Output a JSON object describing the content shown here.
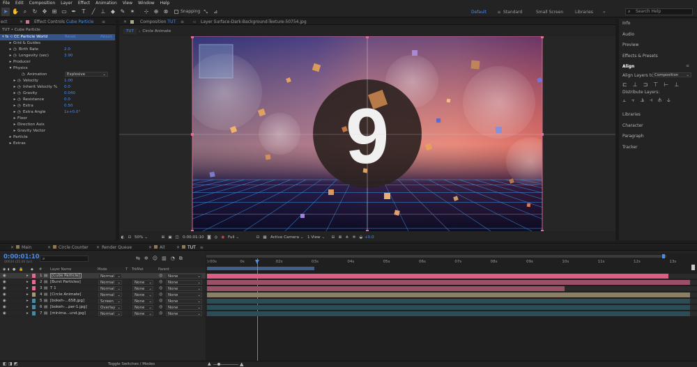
{
  "menu": [
    "File",
    "Edit",
    "Composition",
    "Layer",
    "Effect",
    "Animation",
    "View",
    "Window",
    "Help"
  ],
  "toolbar": {
    "snapping_label": "Snapping",
    "workspaces": [
      "Default",
      "Standard",
      "Small Screen",
      "Libraries"
    ],
    "active_workspace": "Default",
    "search_placeholder": "Search Help"
  },
  "effect_controls": {
    "panel_stub": "ect",
    "tab_prefix": "Effect Controls",
    "tab_layer": "Cube Particle",
    "breadcrumb": "TUT • Cube Particle",
    "effect_name": "CC Particle World",
    "reset_label": "Reset",
    "about_label": "About",
    "rows": [
      {
        "label": "Grid & Guides",
        "value": "",
        "indent": 1,
        "twirl": "▸"
      },
      {
        "label": "Birth Rate",
        "value": "2.0",
        "indent": 1,
        "twirl": "▸",
        "stopwatch": true
      },
      {
        "label": "Longevity (sec)",
        "value": "3.90",
        "indent": 1,
        "twirl": "▸",
        "stopwatch": true
      },
      {
        "label": "Producer",
        "value": "",
        "indent": 1,
        "twirl": "▸"
      },
      {
        "label": "Physics",
        "value": "",
        "indent": 1,
        "twirl": "▾"
      },
      {
        "label": "Animation",
        "value": "",
        "indent": 3,
        "twirl": "",
        "stopwatch": true
      },
      {
        "label": "Velocity",
        "value": "1.00",
        "indent": 2,
        "twirl": "▸",
        "stopwatch": true
      },
      {
        "label": "Inherit Velocity %",
        "value": "0.0",
        "indent": 2,
        "twirl": "▸",
        "stopwatch": true
      },
      {
        "label": "Gravity",
        "value": "0.040",
        "indent": 2,
        "twirl": "▸",
        "stopwatch": true
      },
      {
        "label": "Resistance",
        "value": "0.0",
        "indent": 2,
        "twirl": "▸",
        "stopwatch": true
      },
      {
        "label": "Extra",
        "value": "0.50",
        "indent": 2,
        "twirl": "▸",
        "stopwatch": true
      },
      {
        "label": "Extra Angle",
        "value": "1x+0.0°",
        "indent": 2,
        "twirl": "▸",
        "stopwatch": true
      },
      {
        "label": "Floor",
        "value": "",
        "indent": 2,
        "twirl": "▸"
      },
      {
        "label": "Direction Axis",
        "value": "",
        "indent": 2,
        "twirl": "▸"
      },
      {
        "label": "Gravity Vector",
        "value": "",
        "indent": 2,
        "twirl": "▸"
      },
      {
        "label": "Particle",
        "value": "",
        "indent": 1,
        "twirl": "▸"
      },
      {
        "label": "Extras",
        "value": "",
        "indent": 1,
        "twirl": "▸"
      }
    ],
    "animation_dropdown": "Explosive"
  },
  "composition": {
    "tab_prefix": "Composition",
    "tab_name": "TUT",
    "layer_tab": "Layer Surface-Dark-Background-Texture-50754.jpg",
    "breadcrumbs": [
      "TUT",
      "Circle Animate"
    ],
    "countdown_digit": "9",
    "footer": {
      "zoom": "50%",
      "timecode": "0:00:01:10",
      "resolution": "Full",
      "camera": "Active Camera",
      "view": "1 View",
      "exposure": "+0.0"
    }
  },
  "right_panel": {
    "items_top": [
      "Info",
      "Audio",
      "Preview",
      "Effects & Presets"
    ],
    "align_title": "Align",
    "align_to_label": "Align Layers to:",
    "align_to_value": "Composition",
    "distribute_label": "Distribute Layers:",
    "items_bottom": [
      "Libraries",
      "Character",
      "Paragraph",
      "Tracker"
    ]
  },
  "timeline": {
    "tabs": [
      {
        "label": "Main",
        "color": "#8c7a5a"
      },
      {
        "label": "Circle Counter",
        "color": "#8c7a5a"
      },
      {
        "label": "Render Queue",
        "color": ""
      },
      {
        "label": "All",
        "color": "#8c7a5a"
      },
      {
        "label": "TUT",
        "color": "#8c7a5a"
      }
    ],
    "timecode": "0:00:01:10",
    "frame_info": "00034 (25.00 fps)",
    "search_placeholder": "",
    "columns": {
      "num": "#",
      "layer_name": "Layer Name",
      "mode": "Mode",
      "t": "T",
      "trkmat": "TrkMat",
      "parent": "Parent"
    },
    "ruler_labels": [
      "):00s",
      "0s",
      "02s",
      "03s",
      "04s",
      "05s",
      "06s",
      "07s",
      "08s",
      "09s",
      "10s",
      "11s",
      "12s",
      "13s"
    ],
    "playhead_time_s": 1.4,
    "work_area_end_s": 3.0,
    "duration_s": 13.5,
    "layers": [
      {
        "num": "1",
        "name": "[Cube Particle]",
        "label_color": "#e06d8f",
        "mode": "Normal",
        "trkmat": "",
        "parent": "None",
        "selected": true,
        "bar_color": "#de5d84",
        "start_s": 0.0,
        "end_s": 12.9
      },
      {
        "num": "2",
        "name": "[Burst Particles]",
        "label_color": "#e06d8f",
        "mode": "Normal",
        "trkmat": "None",
        "parent": "None",
        "selected": false,
        "bar_color": "#9a5168",
        "start_s": 0.0,
        "end_s": 13.5
      },
      {
        "num": "3",
        "name": "T 1",
        "label_color": "#e06d8f",
        "mode": "Normal",
        "trkmat": "None",
        "parent": "None",
        "selected": false,
        "bar_color": "#9a5168",
        "start_s": 0.0,
        "end_s": 10.0
      },
      {
        "num": "4",
        "name": "[Circle Animate]",
        "label_color": "#a39a7a",
        "mode": "Normal",
        "trkmat": "None",
        "parent": "None",
        "selected": false,
        "bar_color": "#8a8068",
        "start_s": 0.0,
        "end_s": 13.5
      },
      {
        "num": "5",
        "name": "[bokeh-...658.jpg]",
        "label_color": "#4b8aa0",
        "mode": "Screen",
        "trkmat": "None",
        "parent": "None",
        "selected": false,
        "bar_color": "#2b4d57",
        "start_s": 0.0,
        "end_s": 13.5
      },
      {
        "num": "6",
        "name": "[bokeh-...per-1.jpg]",
        "label_color": "#4b8aa0",
        "mode": "Overlay",
        "trkmat": "None",
        "parent": "None",
        "selected": false,
        "bar_color": "#2b4d57",
        "start_s": 0.0,
        "end_s": 13.5
      },
      {
        "num": "7",
        "name": "[minima...und.jpg]",
        "label_color": "#4b8aa0",
        "mode": "Normal",
        "trkmat": "None",
        "parent": "None",
        "selected": false,
        "bar_color": "#2b4d57",
        "start_s": 0.0,
        "end_s": 13.5
      }
    ],
    "footer_label": "Toggle Switches / Modes"
  }
}
